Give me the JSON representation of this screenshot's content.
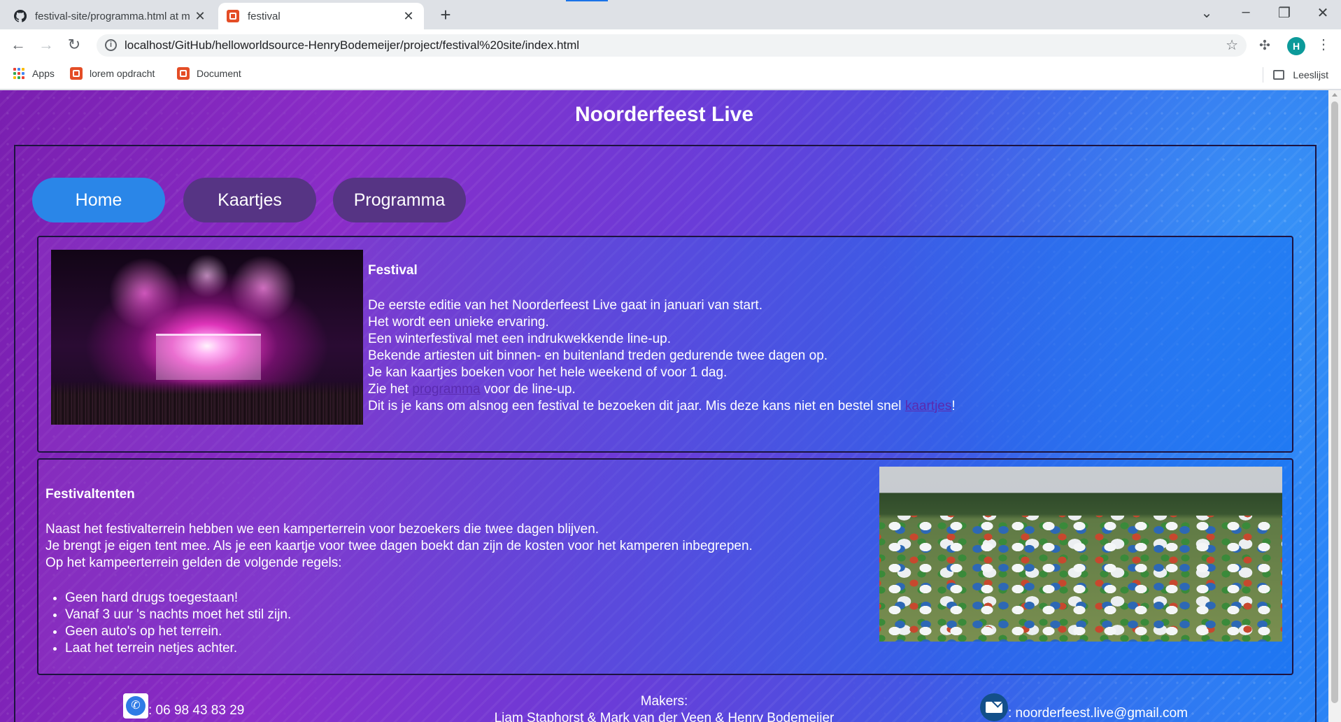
{
  "browser": {
    "tabs": [
      {
        "title": "festival-site/programma.html at m",
        "favicon": "github-icon",
        "active": false
      },
      {
        "title": "festival",
        "favicon": "html-file-icon",
        "active": true
      }
    ],
    "new_tab": "+",
    "url": "localhost/GitHub/helloworldsource-HenryBodemeijer/project/festival%20site/index.html",
    "profile_initial": "H",
    "bookmarks": [
      {
        "label": "Apps",
        "icon": "apps-grid-icon"
      },
      {
        "label": "lorem opdracht",
        "icon": "html-file-icon"
      },
      {
        "label": "Document",
        "icon": "html-file-icon"
      }
    ],
    "reading_list": "Leeslijst"
  },
  "page": {
    "title": "Noorderfeest Live",
    "nav": {
      "home": "Home",
      "tickets": "Kaartjes",
      "program": "Programma"
    },
    "festival_section": {
      "heading": "Festival",
      "lines": [
        "De eerste editie van het Noorderfeest Live gaat in januari van start.",
        "Het wordt een unieke ervaring.",
        "Een winterfestival met een indrukwekkende line-up.",
        "Bekende artiesten uit binnen- en buitenland treden gedurende twee dagen op.",
        "Je kan kaartjes boeken voor het hele weekend of voor 1 dag."
      ],
      "program_prefix": "Zie het",
      "program_link": "programma",
      "program_suffix": "voor de line-up.",
      "last_prefix": "Dit is je kans om alsnog een festival te bezoeken dit jaar. Mis deze kans niet en bestel snel",
      "tickets_link": "kaartjes",
      "last_suffix": "!"
    },
    "tents_section": {
      "heading": "Festivaltenten",
      "lines": [
        "Naast het festivalterrein hebben we een kamperterrein voor bezoekers die twee dagen blijven.",
        "Je brengt je eigen tent mee. Als je een kaartje voor twee dagen boekt dan zijn de kosten voor het kamperen inbegrepen.",
        "Op het kampeerterrein gelden de volgende regels:"
      ],
      "rules": [
        "Geen hard drugs toegestaan!",
        "Vanaf 3 uur 's nachts moet het stil zijn.",
        "Geen auto's op het terrein.",
        "Laat het terrein netjes achter."
      ]
    },
    "footer": {
      "makers_label": "Makers:",
      "makers_names": "Liam Staphorst & Mark van der Veen & Henry Bodemeijer",
      "phone": ": 06 98 43 83 29",
      "email": ": noorderfeest.live@gmail.com"
    }
  },
  "colors": {
    "nav_home": "#2a86e8",
    "nav_inactive": "#563484",
    "link": "#5a2bb0"
  }
}
